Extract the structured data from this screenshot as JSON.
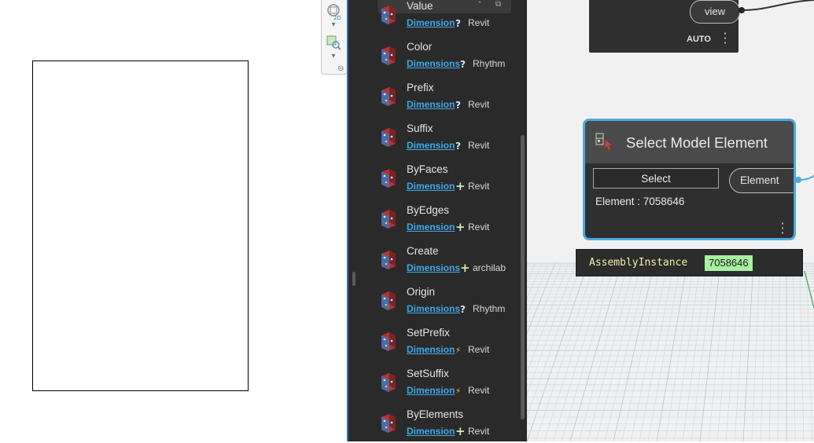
{
  "library": {
    "items": [
      {
        "title": "Value",
        "category": "Dimension",
        "type": "query",
        "package": "Revit"
      },
      {
        "title": "Color",
        "category": "Dimensions",
        "type": "query",
        "package": "Rhythm"
      },
      {
        "title": "Prefix",
        "category": "Dimension",
        "type": "query",
        "package": "Revit"
      },
      {
        "title": "Suffix",
        "category": "Dimension",
        "type": "query",
        "package": "Revit"
      },
      {
        "title": "ByFaces",
        "category": "Dimension",
        "type": "create",
        "package": "Revit"
      },
      {
        "title": "ByEdges",
        "category": "Dimension",
        "type": "create",
        "package": "Revit"
      },
      {
        "title": "Create",
        "category": "Dimensions",
        "type": "create",
        "package": "archilab"
      },
      {
        "title": "Origin",
        "category": "Dimensions",
        "type": "query",
        "package": "Rhythm"
      },
      {
        "title": "SetPrefix",
        "category": "Dimension",
        "type": "action",
        "package": "Revit"
      },
      {
        "title": "SetSuffix",
        "category": "Dimension",
        "type": "action",
        "package": "Revit"
      },
      {
        "title": "ByElements",
        "category": "Dimension",
        "type": "create",
        "package": "Revit"
      }
    ],
    "type_icons": {
      "query": "?",
      "create": "+",
      "action": "⚡"
    },
    "type_colors": {
      "query": "#cfe6f5",
      "create": "#cde8a8",
      "action": "#f0c94a"
    }
  },
  "top_node": {
    "output_port": "view",
    "run_mode": "AUTO"
  },
  "select_node": {
    "title": "Select Model Element",
    "button_label": "Select",
    "output_port": "Element",
    "readout": "Element : 7058646"
  },
  "preview": {
    "key": "AssemblyInstance",
    "value": "7058646"
  },
  "colors": {
    "panel_bg": "#2a2a2a",
    "link_blue": "#3ea8e8",
    "selection_blue": "#4aa9e0",
    "preview_value_bg": "#a6f0a0"
  }
}
